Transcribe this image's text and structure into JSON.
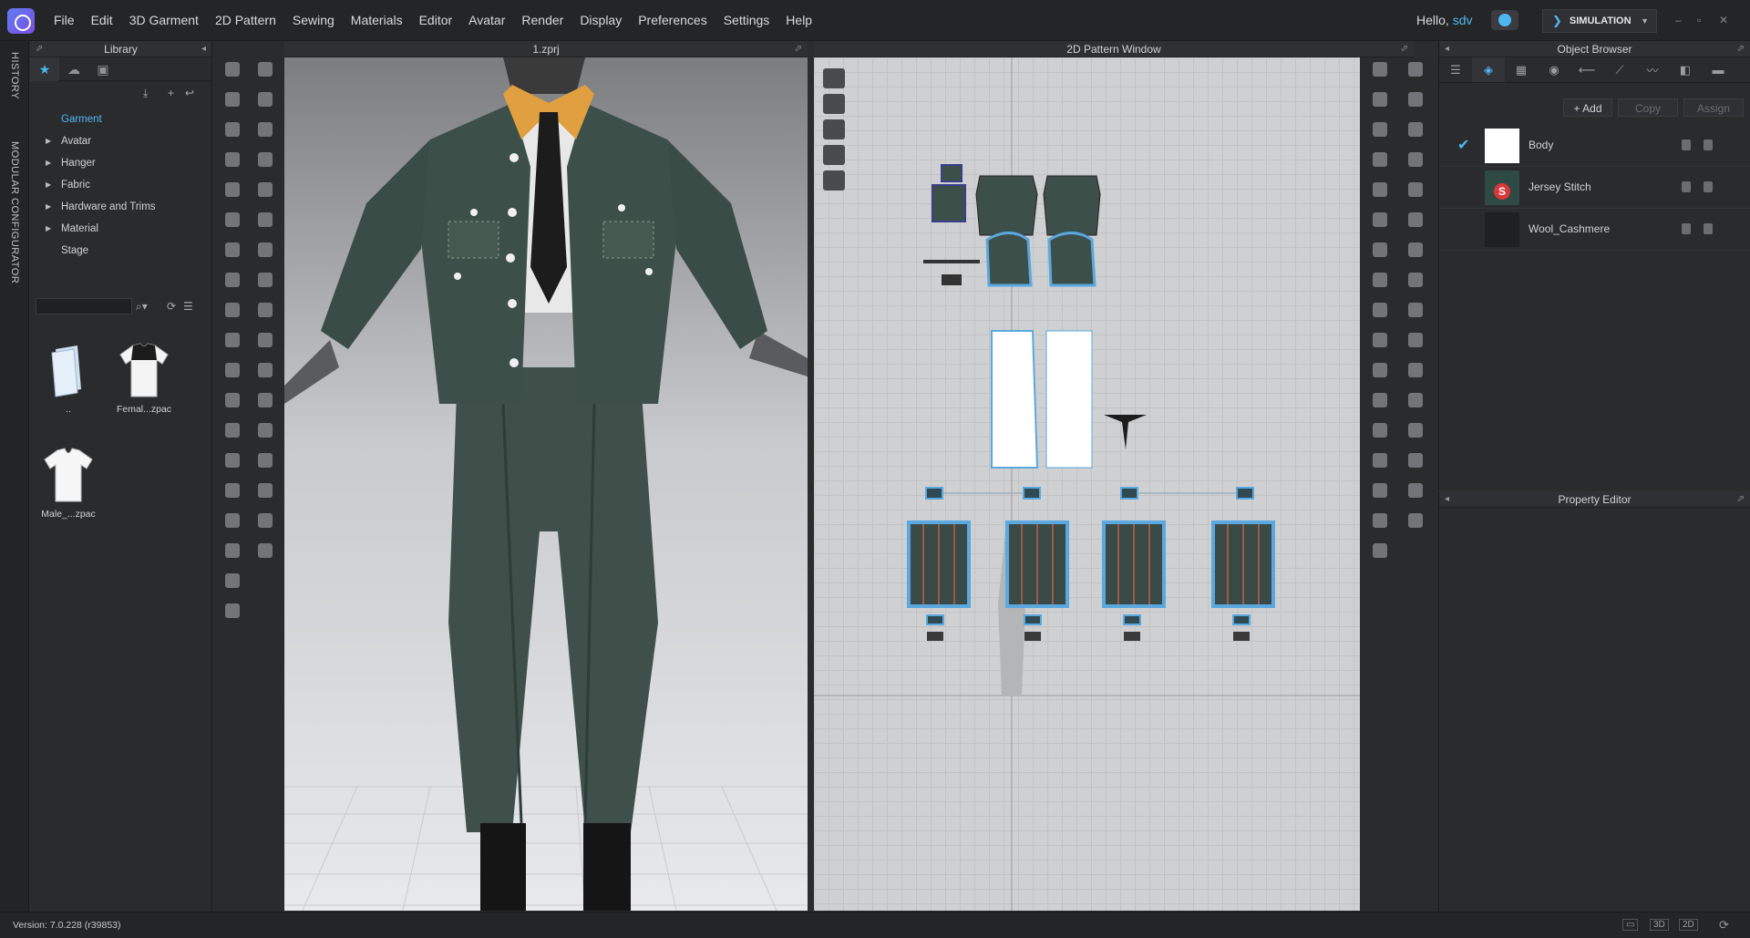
{
  "menubar": {
    "items": [
      "File",
      "Edit",
      "3D Garment",
      "2D Pattern",
      "Sewing",
      "Materials",
      "Editor",
      "Avatar",
      "Render",
      "Display",
      "Preferences",
      "Settings",
      "Help"
    ],
    "greeting": "Hello,",
    "username": "sdv",
    "mode_label": "SIMULATION"
  },
  "side_tabs": {
    "history": "HISTORY",
    "modular": "MODULAR CONFIGURATOR"
  },
  "library": {
    "title": "Library",
    "tree": [
      {
        "label": "Garment",
        "selected": true,
        "expandable": false
      },
      {
        "label": "Avatar",
        "expandable": true
      },
      {
        "label": "Hanger",
        "expandable": true
      },
      {
        "label": "Fabric",
        "expandable": true
      },
      {
        "label": "Hardware and Trims",
        "expandable": true
      },
      {
        "label": "Material",
        "expandable": true
      },
      {
        "label": "Stage",
        "expandable": false
      }
    ],
    "files": [
      {
        "label": "..",
        "icon": "folder-icon"
      },
      {
        "label": "Femal...zpac",
        "icon": "tshirt-icon"
      },
      {
        "label": "Male_...zpac",
        "icon": "tshirt-icon"
      }
    ]
  },
  "viewport3d": {
    "title": "1.zprj"
  },
  "pattern_window": {
    "title": "2D Pattern Window"
  },
  "object_browser": {
    "title": "Object Browser",
    "add_label": "+ Add",
    "copy_label": "Copy",
    "assign_label": "Assign",
    "materials": [
      {
        "name": "Body",
        "checked": true,
        "swatch": "#ffffff"
      },
      {
        "name": "Jersey Stitch",
        "checked": false,
        "swatch": "#2f4a42"
      },
      {
        "name": "Wool_Cashmere",
        "checked": false,
        "swatch": "#1f2022"
      }
    ]
  },
  "property_editor": {
    "title": "Property Editor"
  },
  "status": {
    "version": "Version: 7.0.228 (r39853)",
    "view_buttons": [
      "3D",
      "2D"
    ]
  },
  "colors": {
    "accent": "#4fb7f0",
    "garment": "#3d4f49"
  }
}
